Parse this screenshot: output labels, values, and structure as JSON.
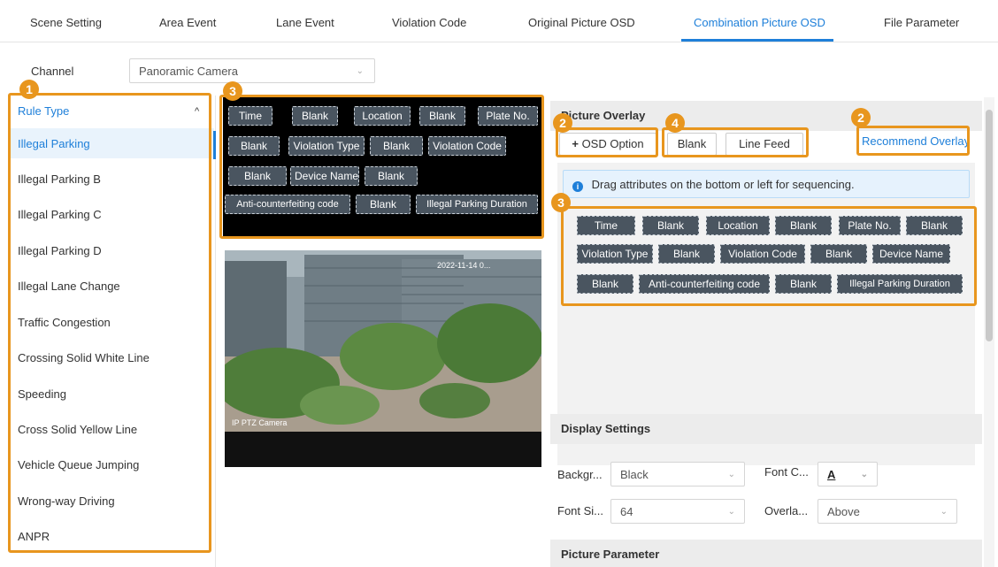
{
  "tabs": [
    {
      "label": "Scene Setting"
    },
    {
      "label": "Area Event"
    },
    {
      "label": "Lane Event"
    },
    {
      "label": "Violation Code"
    },
    {
      "label": "Original Picture OSD"
    },
    {
      "label": "Combination Picture OSD",
      "active": true
    },
    {
      "label": "File Parameter"
    }
  ],
  "channel": {
    "label": "Channel",
    "value": "Panoramic Camera"
  },
  "rule_list": {
    "header": "Rule Type",
    "items": [
      "Illegal Parking",
      "Illegal Parking B",
      "Illegal Parking C",
      "Illegal Parking D",
      "Illegal Lane Change",
      "Traffic Congestion",
      "Crossing Solid White Line",
      "Speeding",
      "Cross Solid Yellow Line",
      "Vehicle Queue Jumping",
      "Wrong-way Driving",
      "ANPR"
    ],
    "selected": "Illegal Parking"
  },
  "preview_tags": [
    [
      "Time",
      "Blank",
      "Location",
      "Blank",
      "Plate No."
    ],
    [
      "Blank",
      "Violation Type",
      "Blank",
      "Violation Code"
    ],
    [
      "Blank",
      "Device Name",
      "Blank"
    ],
    [
      "Anti-counterfeiting code",
      "Blank",
      "Illegal Parking Duration"
    ]
  ],
  "camera": {
    "timestamp": "2022-11-14 0...",
    "watermark": "IP PTZ Camera"
  },
  "picture_overlay": {
    "title": "Picture Overlay",
    "osd_option": "OSD Option",
    "blank_button": "Blank",
    "line_feed_button": "Line Feed",
    "recommend_link": "Recommend Overlay",
    "info_text": "Drag attributes on the bottom or left for sequencing.",
    "tags": [
      [
        "Time",
        "Blank",
        "Location",
        "Blank",
        "Plate No.",
        "Blank"
      ],
      [
        "Violation Type",
        "Blank",
        "Violation Code",
        "Blank",
        "Device Name"
      ],
      [
        "Blank",
        "Anti-counterfeiting code",
        "Blank",
        "Illegal Parking Duration"
      ]
    ]
  },
  "display_settings": {
    "title": "Display Settings",
    "background_label": "Backgr...",
    "background_value": "Black",
    "font_color_label": "Font C...",
    "font_color_value": "A",
    "font_size_label": "Font Si...",
    "font_size_value": "64",
    "overlay_label": "Overla...",
    "overlay_value": "Above"
  },
  "picture_parameter": {
    "title": "Picture Parameter"
  },
  "badges": [
    "1",
    "3",
    "2",
    "4",
    "2",
    "3"
  ],
  "colors": {
    "accent": "#1e7fd9",
    "annotation": "#e8961e",
    "tag_bg": "#4a5560"
  }
}
